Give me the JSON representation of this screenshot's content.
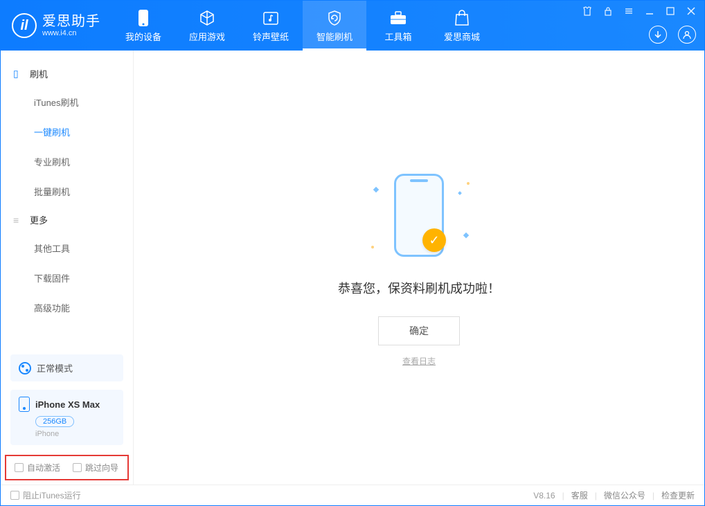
{
  "brand": {
    "title": "爱思助手",
    "subtitle": "www.i4.cn"
  },
  "nav": {
    "device": "我的设备",
    "apps": "应用游戏",
    "ring": "铃声壁纸",
    "flash": "智能刷机",
    "tools": "工具箱",
    "store": "爱思商城"
  },
  "sidebar": {
    "group_flash": "刷机",
    "items_flash": {
      "itunes": "iTunes刷机",
      "onekey": "一键刷机",
      "pro": "专业刷机",
      "batch": "批量刷机"
    },
    "group_more": "更多",
    "items_more": {
      "other": "其他工具",
      "firmware": "下载固件",
      "adv": "高级功能"
    },
    "mode": "正常模式",
    "device": {
      "name": "iPhone XS Max",
      "capacity": "256GB",
      "type": "iPhone"
    },
    "options": {
      "auto_activate": "自动激活",
      "skip_guide": "跳过向导"
    }
  },
  "main": {
    "message": "恭喜您，保资料刷机成功啦！",
    "ok": "确定",
    "view_log": "查看日志"
  },
  "footer": {
    "block_itunes": "阻止iTunes运行",
    "version": "V8.16",
    "support": "客服",
    "wechat": "微信公众号",
    "update": "检查更新"
  }
}
